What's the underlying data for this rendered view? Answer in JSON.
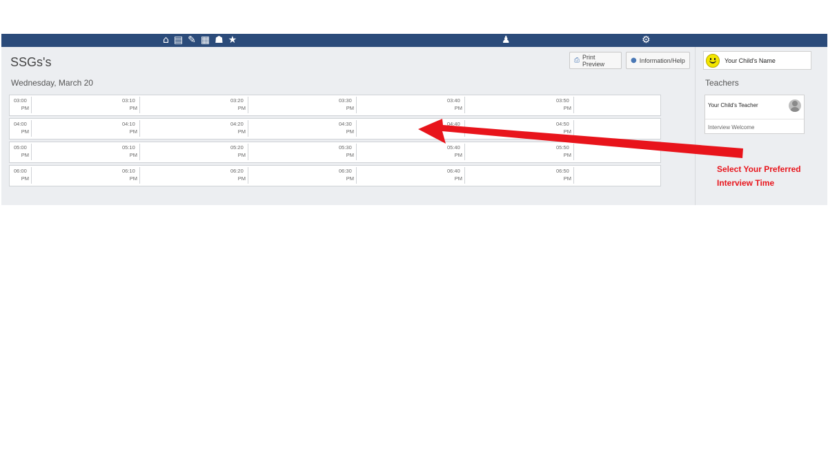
{
  "topbar": {
    "icons": [
      "home-icon",
      "calendar-icon",
      "pencil-icon",
      "grid-icon",
      "people-icon",
      "star-icon"
    ],
    "right_icons": [
      "person-icon",
      "gear-icon"
    ]
  },
  "page": {
    "title": "SSGs's",
    "date": "Wednesday, March 20"
  },
  "buttons": {
    "print_preview": "Print Preview",
    "info_help": "Information/Help"
  },
  "sidebar": {
    "child_name": "Your Child's Name",
    "teachers_label": "Teachers",
    "teacher_name": "Your Child's Teacher",
    "teacher_subtitle": "Interview Welcome"
  },
  "slots": [
    [
      {
        "time": "03:00",
        "ampm": "PM"
      },
      {
        "time": "03:10",
        "ampm": "PM"
      },
      {
        "time": "03:20",
        "ampm": "PM"
      },
      {
        "time": "03:30",
        "ampm": "PM"
      },
      {
        "time": "03:40",
        "ampm": "PM"
      },
      {
        "time": "03:50",
        "ampm": "PM"
      }
    ],
    [
      {
        "time": "04:00",
        "ampm": "PM"
      },
      {
        "time": "04:10",
        "ampm": "PM"
      },
      {
        "time": "04:20",
        "ampm": "PM"
      },
      {
        "time": "04:30",
        "ampm": "PM"
      },
      {
        "time": "04:40",
        "ampm": ""
      },
      {
        "time": "04:50",
        "ampm": "PM"
      }
    ],
    [
      {
        "time": "05:00",
        "ampm": "PM"
      },
      {
        "time": "05:10",
        "ampm": "PM"
      },
      {
        "time": "05:20",
        "ampm": "PM"
      },
      {
        "time": "05:30",
        "ampm": "PM"
      },
      {
        "time": "05:40",
        "ampm": "PM"
      },
      {
        "time": "05:50",
        "ampm": "PM"
      }
    ],
    [
      {
        "time": "06:00",
        "ampm": "PM"
      },
      {
        "time": "06:10",
        "ampm": "PM"
      },
      {
        "time": "06:20",
        "ampm": "PM"
      },
      {
        "time": "06:30",
        "ampm": "PM"
      },
      {
        "time": "06:40",
        "ampm": "PM"
      },
      {
        "time": "06:50",
        "ampm": "PM"
      }
    ]
  ],
  "annotation": {
    "line1": "Select Your Preferred",
    "line2": "Interview Time",
    "color": "#e8141b"
  },
  "colors": {
    "topbar": "#2b4b7a",
    "background": "#eceef1"
  }
}
